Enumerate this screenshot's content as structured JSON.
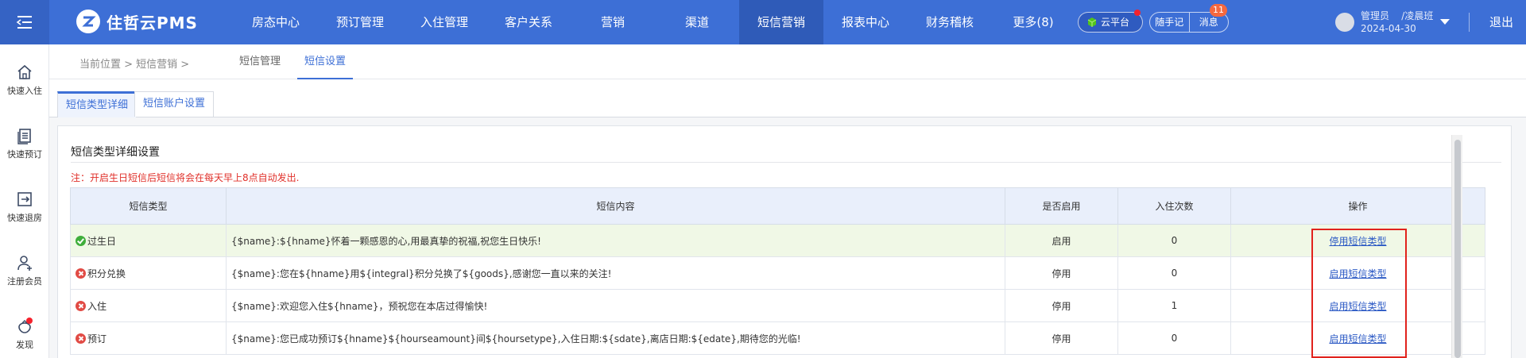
{
  "app": {
    "brand": "住哲云PMS"
  },
  "nav": {
    "items": [
      {
        "label": "房态中心"
      },
      {
        "label": "预订管理"
      },
      {
        "label": "入住管理"
      },
      {
        "label": "客户关系"
      },
      {
        "label": "营销"
      },
      {
        "label": "渠道"
      },
      {
        "label": "短信营销",
        "active": true
      },
      {
        "label": "报表中心"
      },
      {
        "label": "财务稽核"
      },
      {
        "label": "更多(8)"
      }
    ],
    "cloud_label": "云平台",
    "notes_label": "随手记",
    "messages_label": "消息",
    "messages_badge": "11",
    "logout_label": "退出"
  },
  "user": {
    "role": "管理员",
    "shift": "/凌晨班",
    "date": "2024-04-30"
  },
  "sidebar": {
    "items": [
      {
        "label": "快速入住",
        "icon": "home-icon"
      },
      {
        "label": "快速预订",
        "icon": "clipboard-icon"
      },
      {
        "label": "快速退房",
        "icon": "checkout-icon"
      },
      {
        "label": "注册会员",
        "icon": "add-user-icon"
      },
      {
        "label": "发现",
        "icon": "discover-icon"
      }
    ]
  },
  "breadcrumb": {
    "text": "当前位置 > 短信营销 >",
    "tabs": [
      {
        "label": "短信管理"
      },
      {
        "label": "短信设置",
        "active": true
      }
    ]
  },
  "subtabs": [
    {
      "label": "短信类型详细",
      "active": true
    },
    {
      "label": "短信账户设置"
    }
  ],
  "panel": {
    "title": "短信类型详细设置",
    "note": "注：开启生日短信后短信将会在每天早上8点自动发出."
  },
  "table": {
    "headers": [
      "短信类型",
      "短信内容",
      "是否启用",
      "入住次数",
      "操作"
    ],
    "rows": [
      {
        "status": "enabled",
        "type": "过生日",
        "content": "{$name}:${hname}怀着一颗感恩的心,用最真挚的祝福,祝您生日快乐!",
        "enabled": "启用",
        "count": "0",
        "action": "停用短信类型"
      },
      {
        "status": "disabled",
        "type": "积分兑换",
        "content": "{$name}:您在${hname}用${integral}积分兑换了${goods},感谢您一直以来的关注!",
        "enabled": "停用",
        "count": "0",
        "action": "启用短信类型"
      },
      {
        "status": "disabled",
        "type": "入住",
        "content": "{$name}:欢迎您入住${hname}，预祝您在本店过得愉快!",
        "enabled": "停用",
        "count": "1",
        "action": "启用短信类型"
      },
      {
        "status": "disabled",
        "type": "预订",
        "content": "{$name}:您已成功预订${hname}${hourseamount}间${hoursetype},入住日期:${sdate},离店日期:${edate},期待您的光临!",
        "enabled": "停用",
        "count": "0",
        "action": "启用短信类型"
      }
    ]
  },
  "colors": {
    "topbar": "#3d6fd6",
    "accent": "#3d6fd6",
    "enabled_row": "#f0f8e6",
    "warning_text": "#e0302a",
    "highlight_border": "#e1221c"
  }
}
